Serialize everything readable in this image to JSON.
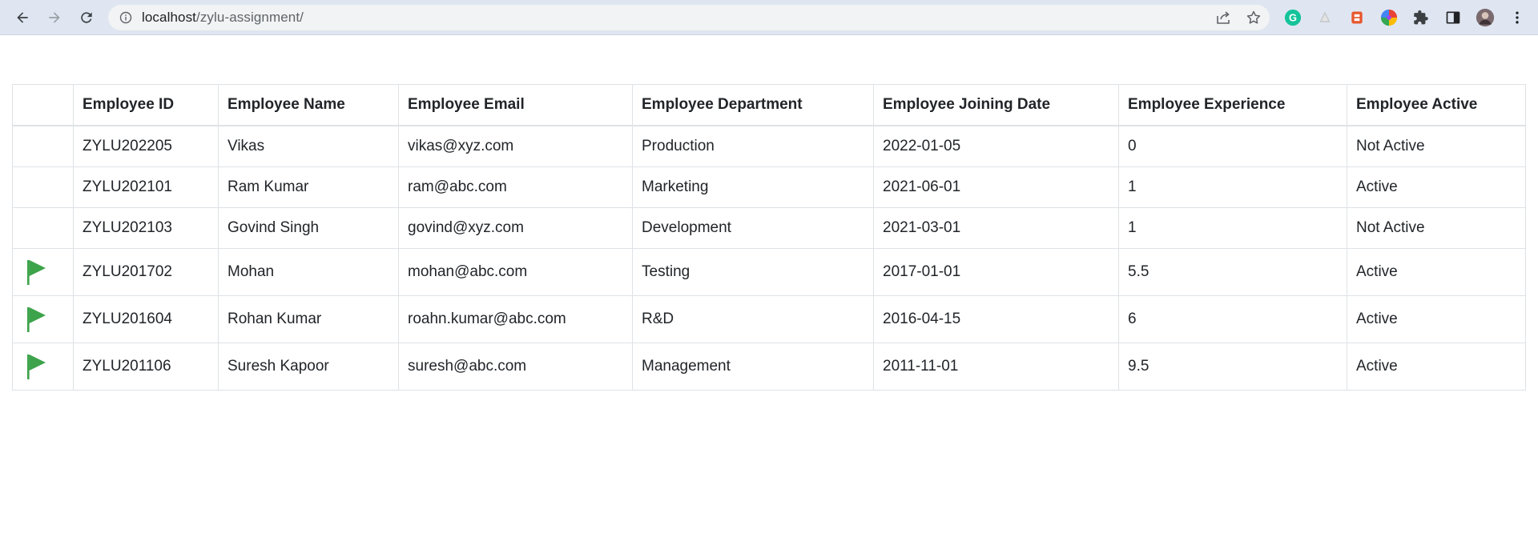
{
  "browser": {
    "url_host": "localhost",
    "url_path": "/zylu-assignment/",
    "icons": [
      "back-arrow-icon",
      "forward-arrow-icon",
      "reload-icon",
      "site-info-icon",
      "share-icon",
      "star-icon",
      "grammarly-icon",
      "drive-icon",
      "extension-red-icon",
      "color-wheel-icon",
      "puzzle-icon",
      "side-panel-icon",
      "avatar",
      "menu-kebab-icon"
    ]
  },
  "table": {
    "headers": [
      "",
      "Employee ID",
      "Employee Name",
      "Employee Email",
      "Employee Department",
      "Employee Joining Date",
      "Employee Experience",
      "Employee Active"
    ],
    "flag_color": "#3da34b",
    "rows": [
      {
        "flag": false,
        "id": "ZYLU202205",
        "name": "Vikas",
        "email": "vikas@xyz.com",
        "department": "Production",
        "joining_date": "2022-01-05",
        "experience": "0",
        "active": "Not Active"
      },
      {
        "flag": false,
        "id": "ZYLU202101",
        "name": "Ram Kumar",
        "email": "ram@abc.com",
        "department": "Marketing",
        "joining_date": "2021-06-01",
        "experience": "1",
        "active": "Active"
      },
      {
        "flag": false,
        "id": "ZYLU202103",
        "name": "Govind Singh",
        "email": "govind@xyz.com",
        "department": "Development",
        "joining_date": "2021-03-01",
        "experience": "1",
        "active": "Not Active"
      },
      {
        "flag": true,
        "id": "ZYLU201702",
        "name": "Mohan",
        "email": "mohan@abc.com",
        "department": "Testing",
        "joining_date": "2017-01-01",
        "experience": "5.5",
        "active": "Active"
      },
      {
        "flag": true,
        "id": "ZYLU201604",
        "name": "Rohan Kumar",
        "email": "roahn.kumar@abc.com",
        "department": "R&D",
        "joining_date": "2016-04-15",
        "experience": "6",
        "active": "Active"
      },
      {
        "flag": true,
        "id": "ZYLU201106",
        "name": "Suresh Kapoor",
        "email": "suresh@abc.com",
        "department": "Management",
        "joining_date": "2011-11-01",
        "experience": "9.5",
        "active": "Active"
      }
    ]
  }
}
